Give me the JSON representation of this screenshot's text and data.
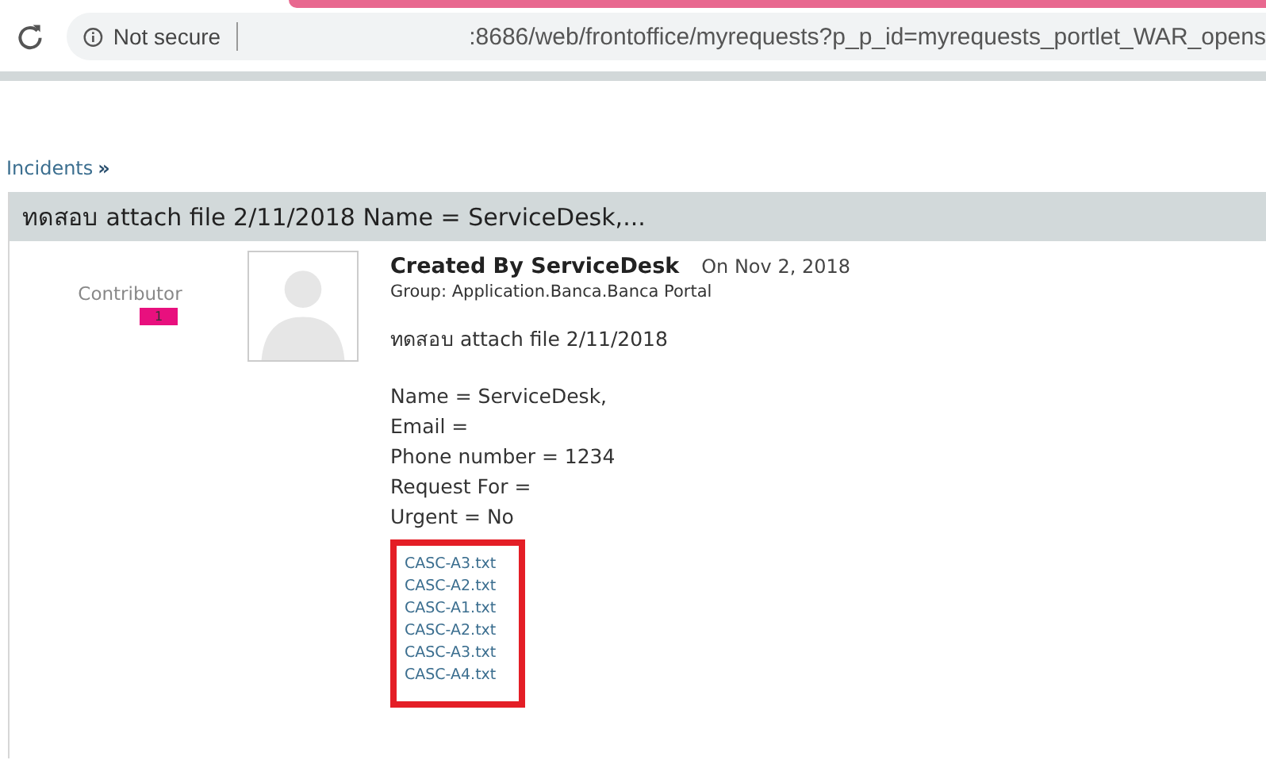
{
  "browser": {
    "security": "Not secure",
    "url": ":8686/web/frontoffice/myrequests?p_p_id=myrequests_portlet_WAR_opens"
  },
  "breadcrumb": {
    "link": "Incidents",
    "separator": "»"
  },
  "panel": {
    "title": "ทดสอบ attach file 2/11/2018 Name = ServiceDesk,...",
    "role": "Contributor",
    "badge": "1",
    "author": "Created By ServiceDesk",
    "date": "On Nov 2, 2018",
    "group": "Group: Application.Banca.Banca Portal",
    "subject": "ทดสอบ attach file 2/11/2018",
    "fields": [
      "Name = ServiceDesk,",
      "Email =",
      "Phone number = 1234",
      "Request For =",
      "Urgent = No"
    ],
    "attachments": [
      "CASC-A3.txt",
      "CASC-A2.txt",
      "CASC-A1.txt",
      "CASC-A2.txt",
      "CASC-A3.txt",
      "CASC-A4.txt"
    ]
  }
}
